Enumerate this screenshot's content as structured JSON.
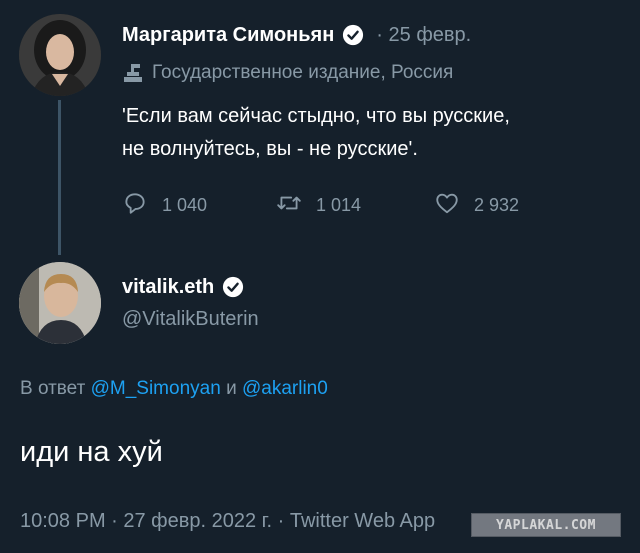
{
  "tweet1": {
    "author_name": "Маргарита Симоньян",
    "date": "· 25 февр.",
    "label": "Государственное издание, Россия",
    "text": "'Если вам сейчас стыдно, что вы русские,\nне волнуйтесь, вы - не русские'.",
    "replies": "1 040",
    "retweets": "1 014",
    "likes": "2 932"
  },
  "tweet2": {
    "author_name": "vitalik.eth",
    "handle": "@VitalikButerin",
    "reply_prefix": "В ответ",
    "mention1": "@M_Simonyan",
    "reply_and": "и",
    "mention2": "@akarlin0",
    "text": "иди на хуй",
    "footer": "10:08 PM · 27 февр. 2022 г. · Twitter Web App"
  },
  "watermark": "YAPLAKAL.COM",
  "colors": {
    "background": "#15202b",
    "secondary_text": "#8899a6",
    "link": "#1da1f2",
    "thread_line": "#3d5466"
  },
  "icons": [
    "verified-icon",
    "state-media-icon",
    "reply-icon",
    "retweet-icon",
    "like-icon"
  ]
}
